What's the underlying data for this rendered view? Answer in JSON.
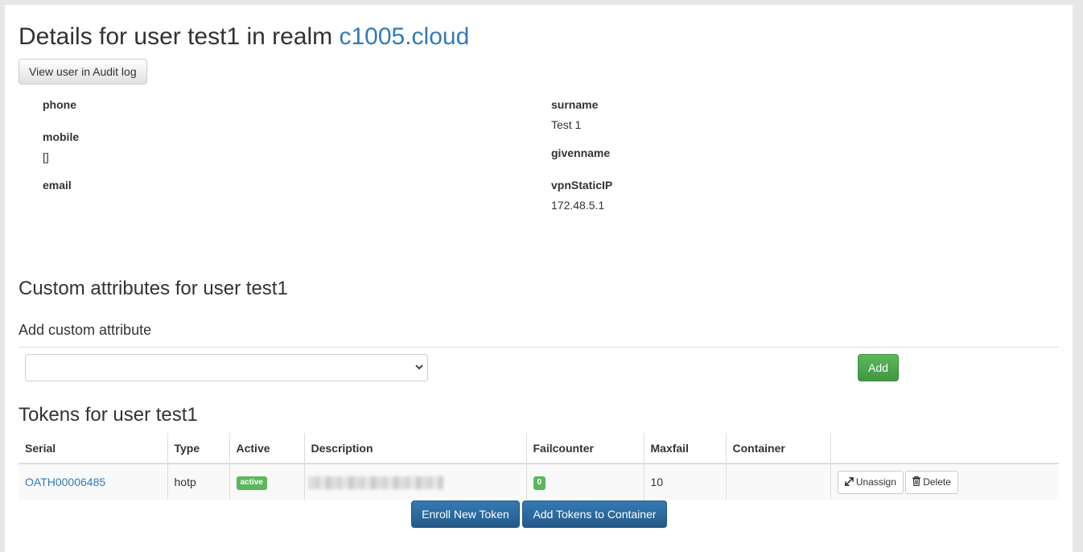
{
  "header": {
    "title_prefix": "Details for user test1 in realm ",
    "realm": "c1005.cloud",
    "audit_button": "View user in Audit log"
  },
  "user_attributes": {
    "left": [
      {
        "key": "phone",
        "value": ""
      },
      {
        "key": "mobile",
        "value": "[]"
      },
      {
        "key": "email",
        "value": ""
      }
    ],
    "right": [
      {
        "key": "surname",
        "value": "Test 1"
      },
      {
        "key": "givenname",
        "value": ""
      },
      {
        "key": "vpnStaticIP",
        "value": "172.48.5.1"
      }
    ]
  },
  "custom_attributes": {
    "heading": "Custom attributes for user test1",
    "add_heading": "Add custom attribute",
    "select_value": "",
    "add_button": "Add"
  },
  "tokens": {
    "heading": "Tokens for user test1",
    "columns": [
      "Serial",
      "Type",
      "Active",
      "Description",
      "Failcounter",
      "Maxfail",
      "Container",
      ""
    ],
    "rows": [
      {
        "serial": "OATH00006485",
        "type": "hotp",
        "active": "active",
        "description": "",
        "failcounter": "0",
        "maxfail": "10",
        "container": "",
        "unassign": "Unassign",
        "delete": "Delete"
      }
    ],
    "enroll_button": "Enroll New Token",
    "add_to_container_button": "Add Tokens to Container"
  },
  "colors": {
    "link": "#337ab7",
    "success": "#5cb85c",
    "primary": "#337ab7"
  }
}
